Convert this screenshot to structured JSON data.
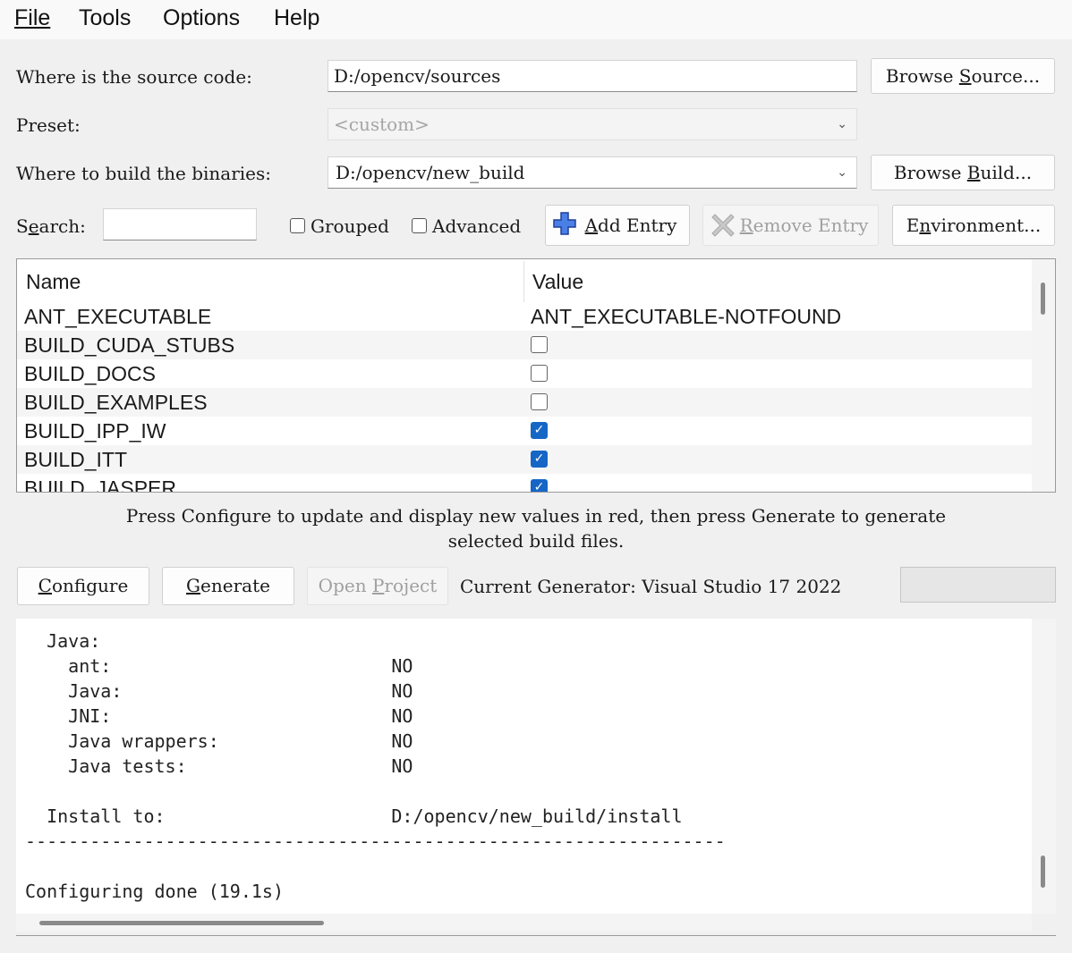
{
  "menu": {
    "file": "File",
    "tools": "Tools",
    "options": "Options",
    "help": "Help"
  },
  "source": {
    "label": "Where is the source code:",
    "value": "D:/opencv/sources",
    "browse_label": "Browse Source..."
  },
  "preset": {
    "label": "Preset:",
    "value": "<custom>"
  },
  "build": {
    "label": "Where to build the binaries:",
    "value": "D:/opencv/new_build",
    "browse_label": "Browse Build..."
  },
  "toolbar": {
    "search_label": "Search:",
    "search_value": "",
    "grouped_label": "Grouped",
    "grouped_checked": false,
    "advanced_label": "Advanced",
    "advanced_checked": false,
    "add_entry_label": "Add Entry",
    "remove_entry_label": "Remove Entry",
    "environment_label": "Environment..."
  },
  "table": {
    "headers": {
      "name": "Name",
      "value": "Value"
    },
    "rows": [
      {
        "name": "ANT_EXECUTABLE",
        "value": "ANT_EXECUTABLE-NOTFOUND",
        "type": "text"
      },
      {
        "name": "BUILD_CUDA_STUBS",
        "checked": false,
        "type": "bool"
      },
      {
        "name": "BUILD_DOCS",
        "checked": false,
        "type": "bool"
      },
      {
        "name": "BUILD_EXAMPLES",
        "checked": false,
        "type": "bool"
      },
      {
        "name": "BUILD_IPP_IW",
        "checked": true,
        "type": "bool"
      },
      {
        "name": "BUILD_ITT",
        "checked": true,
        "type": "bool"
      },
      {
        "name": "BUILD_JASPER",
        "checked": true,
        "type": "bool"
      }
    ]
  },
  "hint": {
    "line1": "Press Configure to update and display new values in red, then press Generate to generate",
    "line2": "selected build files."
  },
  "actions": {
    "configure_label": "Configure",
    "generate_label": "Generate",
    "open_project_label": "Open Project",
    "generator_text": "Current Generator: Visual Studio 17 2022"
  },
  "output": {
    "lines": [
      "  Java:",
      "    ant:                          NO",
      "    Java:                         NO",
      "    JNI:                          NO",
      "    Java wrappers:                NO",
      "    Java tests:                   NO",
      "",
      "  Install to:                     D:/opencv/new_build/install",
      "-----------------------------------------------------------------",
      "",
      "Configuring done (19.1s)"
    ]
  },
  "colors": {
    "accent": "#1666c6",
    "window_bg": "#f0f0f0",
    "add_icon": "#2f5fcf"
  },
  "icons": {
    "add": "plus-icon",
    "remove": "x-icon",
    "chevron": "chevron-down-icon",
    "check": "checkmark-icon"
  }
}
